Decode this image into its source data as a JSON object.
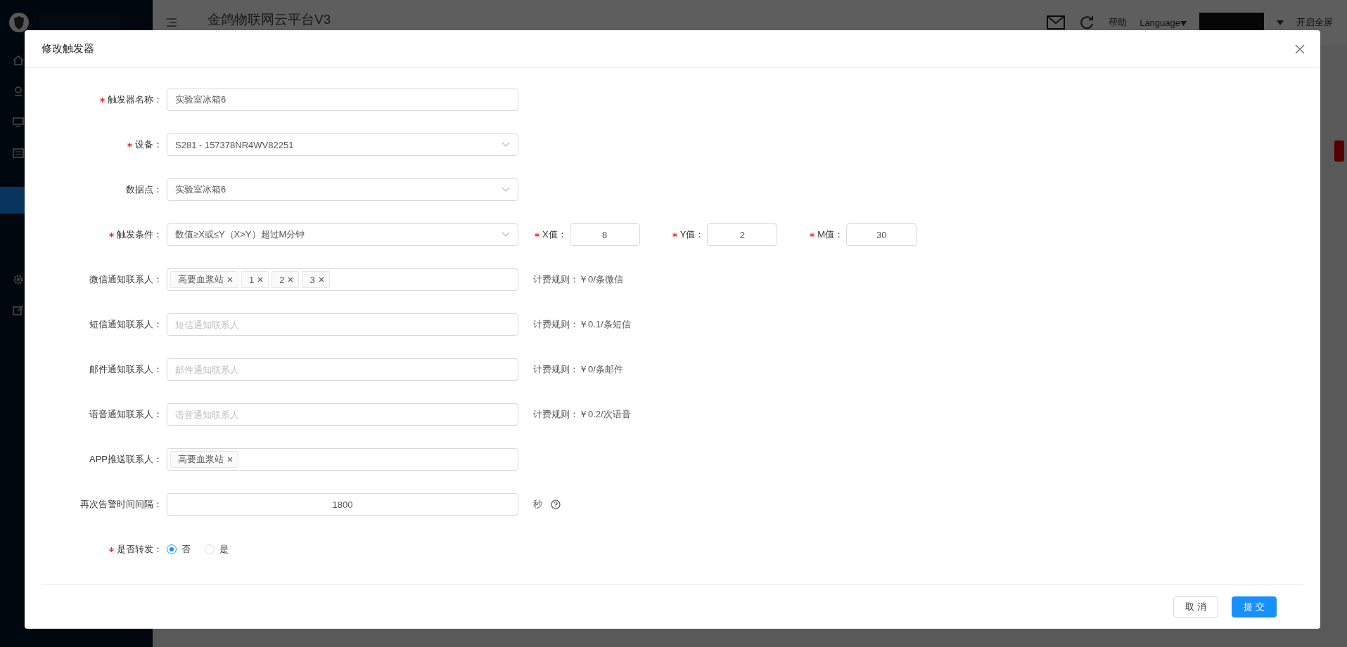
{
  "header": {
    "title": "金鸽物联网云平台V3",
    "help": "帮助",
    "language": "Language",
    "fullscreen": "开启全屏"
  },
  "dialog": {
    "title": "修改触发器",
    "fields": [
      {
        "kind": "input",
        "label": "触发器名称：",
        "required": true,
        "value": "实验室冰箱6"
      },
      {
        "kind": "select",
        "label": "设备：",
        "required": true,
        "value": "S281 - 157378NR4WV82251"
      },
      {
        "kind": "select",
        "label": "数据点：",
        "required": false,
        "value": "实验室冰箱6"
      },
      {
        "kind": "select",
        "label": "触发条件：",
        "required": true,
        "value": "数值≥X或≤Y（X>Y）超过M分钟",
        "extras": [
          {
            "label": "X值：",
            "required": true,
            "value": "8"
          },
          {
            "label": "Y值：",
            "required": true,
            "value": "2"
          },
          {
            "label": "M值：",
            "required": true,
            "value": "30"
          }
        ]
      },
      {
        "kind": "tags",
        "label": "微信通知联系人：",
        "required": false,
        "tags": [
          "高要血浆站",
          "1",
          "2",
          "3"
        ],
        "note": "计费规则：￥0/条微信"
      },
      {
        "kind": "input",
        "label": "短信通知联系人：",
        "required": false,
        "placeholder": "短信通知联系人",
        "note": "计费规则：￥0.1/条短信"
      },
      {
        "kind": "input",
        "label": "邮件通知联系人：",
        "required": false,
        "placeholder": "邮件通知联系人",
        "note": "计费规则：￥0/条邮件"
      },
      {
        "kind": "input",
        "label": "语音通知联系人：",
        "required": false,
        "placeholder": "语音通知联系人",
        "note": "计费规则：￥0.2/次语音"
      },
      {
        "kind": "tags",
        "label": "APP推送联系人：",
        "required": false,
        "tags": [
          "高要血浆站"
        ]
      },
      {
        "kind": "number",
        "label": "再次告警时间间隔：",
        "required": false,
        "value": "1800",
        "suffix": "秒"
      },
      {
        "kind": "radio",
        "label": "是否转发：",
        "required": true,
        "options": [
          {
            "label": "否",
            "selected": true
          },
          {
            "label": "是",
            "selected": false
          }
        ]
      }
    ],
    "buttons": [
      {
        "label": "取 消",
        "kind": "default"
      },
      {
        "label": "提 交",
        "kind": "primary"
      }
    ]
  }
}
